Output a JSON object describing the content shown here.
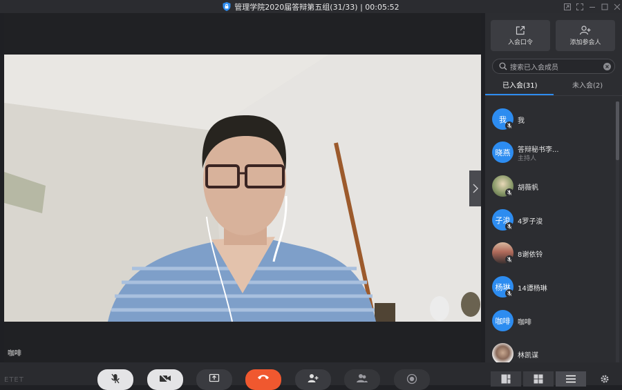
{
  "window": {
    "title": "管理学院2020届答辩第五组(31/33) | 00:05:52"
  },
  "video": {
    "speaker_name": "咖啡"
  },
  "watermark": "ETET",
  "panel": {
    "invite_label": "入会口令",
    "add_label": "添加参会人",
    "search_placeholder": "搜索已入会成员",
    "tab_joined": "已入会(31)",
    "tab_not_joined": "未入会(2)",
    "members": [
      {
        "avatar_text": "我",
        "name": "我",
        "role": ""
      },
      {
        "avatar_text": "晓燕",
        "name": "答辩秘书李...",
        "role": "主持人"
      },
      {
        "avatar_text": "",
        "name": "胡薇帆",
        "role": ""
      },
      {
        "avatar_text": "子浚",
        "name": "4罗子浚",
        "role": ""
      },
      {
        "avatar_text": "",
        "name": "8谢依铃",
        "role": ""
      },
      {
        "avatar_text": "杨琳",
        "name": "14谭杨琳",
        "role": ""
      },
      {
        "avatar_text": "咖啡",
        "name": "咖啡",
        "role": ""
      },
      {
        "avatar_text": "",
        "name": "林凯谋",
        "role": ""
      }
    ]
  },
  "colors": {
    "accent": "#2d8cf0",
    "hangup": "#f0582f",
    "panel_bg": "#2c2d31"
  }
}
